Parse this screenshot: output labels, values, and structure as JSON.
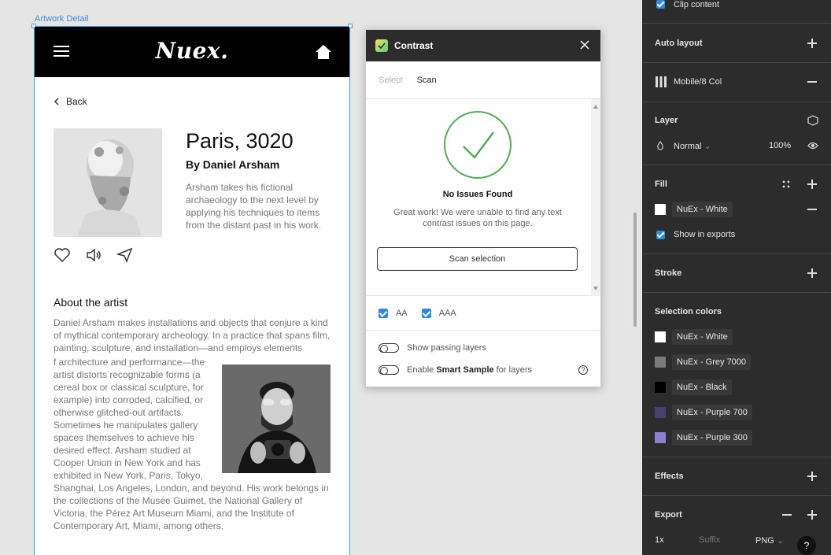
{
  "canvas": {
    "frame_label": "Artwork Detail"
  },
  "app": {
    "brand": "Nuex.",
    "back_label": "Back",
    "artwork_title": "Paris, 3020",
    "artist_byline": "By Daniel Arsham",
    "artwork_description": "Arsham takes his fictional archaeology to the next level by applying his techniques to items from the distant past in his work.",
    "about_heading": "About the artist",
    "bio_part1": "Daniel Arsham makes installations and objects that conjure a kind of mythical contemporary archeology. In a practice that spans film, painting, sculpture, and installation—and employs elements",
    "bio_part2": "f architecture and performance—the artist distorts recognizable forms (a cereal box or classical sculpture, for example) into corroded, calcified, or otherwise glitched-out artifacts. Sometimes he manipulates gallery spaces themselves to achieve his desired effect. Arsham studied at Cooper Union in New York and has exhibited in New York, Paris, Tokyo,",
    "bio_part3": "Shanghai, Los Angeles, London, and beyond. His work belongs in the collections of the Musée Guimet, the National Gallery of Victoria, the Pérez Art Museum Miami, and the Institute of Contemporary Art, Miami, among others."
  },
  "plugin": {
    "title": "Contrast",
    "tabs": [
      "Select",
      "Scan"
    ],
    "result_title": "No Issues Found",
    "result_text": "Great work! We were unable to find any text contrast issues on this page.",
    "scan_button": "Scan selection",
    "levels": [
      "AA",
      "AAA"
    ],
    "toggle_passing": "Show passing layers",
    "toggle_smart_prefix": "Enable ",
    "toggle_smart_bold": "Smart Sample",
    "toggle_smart_suffix": " for layers",
    "help": "?"
  },
  "panel": {
    "clip_content": "Clip content",
    "auto_layout": "Auto layout",
    "layout_grid": "Mobile/8 Col",
    "layer_title": "Layer",
    "blend_mode": "Normal",
    "opacity": "100%",
    "fill_title": "Fill",
    "fill_style": "NuEx - White",
    "show_in_exports": "Show in exports",
    "stroke_title": "Stroke",
    "selection_colors_title": "Selection colors",
    "selection_colors": [
      {
        "name": "NuEx - White",
        "color": "#ffffff"
      },
      {
        "name": "NuEx - Grey 7000",
        "color": "#7a7a7a"
      },
      {
        "name": "NuEx - Black",
        "color": "#000000"
      },
      {
        "name": "NuEx - Purple 700",
        "color": "#4b3f72"
      },
      {
        "name": "NuEx - Purple 300",
        "color": "#8f7fd0"
      }
    ],
    "effects_title": "Effects",
    "export_title": "Export",
    "export_scale": "1x",
    "export_suffix_placeholder": "Suffix",
    "export_format": "PNG",
    "help": "?"
  },
  "colors": {
    "accent": "#2a8be6",
    "success": "#4caf50",
    "panel_bg": "#2c2c2c"
  }
}
